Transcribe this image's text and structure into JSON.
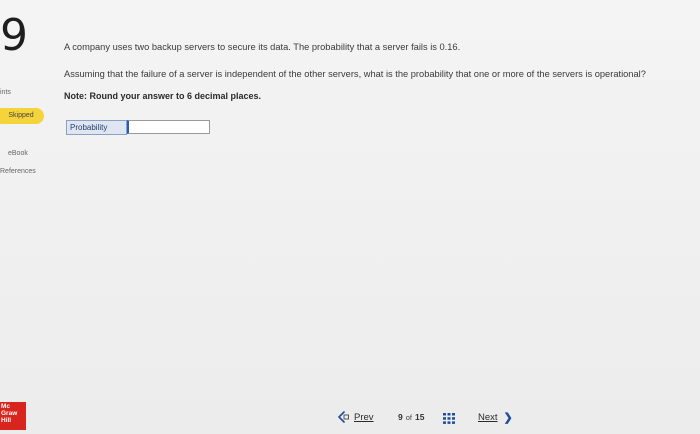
{
  "question": {
    "number": "9",
    "line1": "A company uses two backup servers to secure its data. The probability that a server fails is 0.16.",
    "line2": "Assuming that the failure of a server is independent of the other servers, what is the probability that one or more of the servers is operational?",
    "note": "Note: Round your answer to 6 decimal places."
  },
  "sidebar": {
    "points_label": "ints",
    "status_badge": "Skipped",
    "ebook_link": "eBook",
    "references_link": "References"
  },
  "answer": {
    "label": "Probability",
    "value": ""
  },
  "footer": {
    "logo_lines": [
      "Mc",
      "Graw",
      "Hill"
    ],
    "prev_label": "Prev",
    "current_page": "9",
    "of_label": "of",
    "total_pages": "15",
    "next_label": "Next"
  },
  "colors": {
    "badge": "#f5d33a",
    "logo": "#d8251d",
    "accent": "#1d4f9c"
  }
}
